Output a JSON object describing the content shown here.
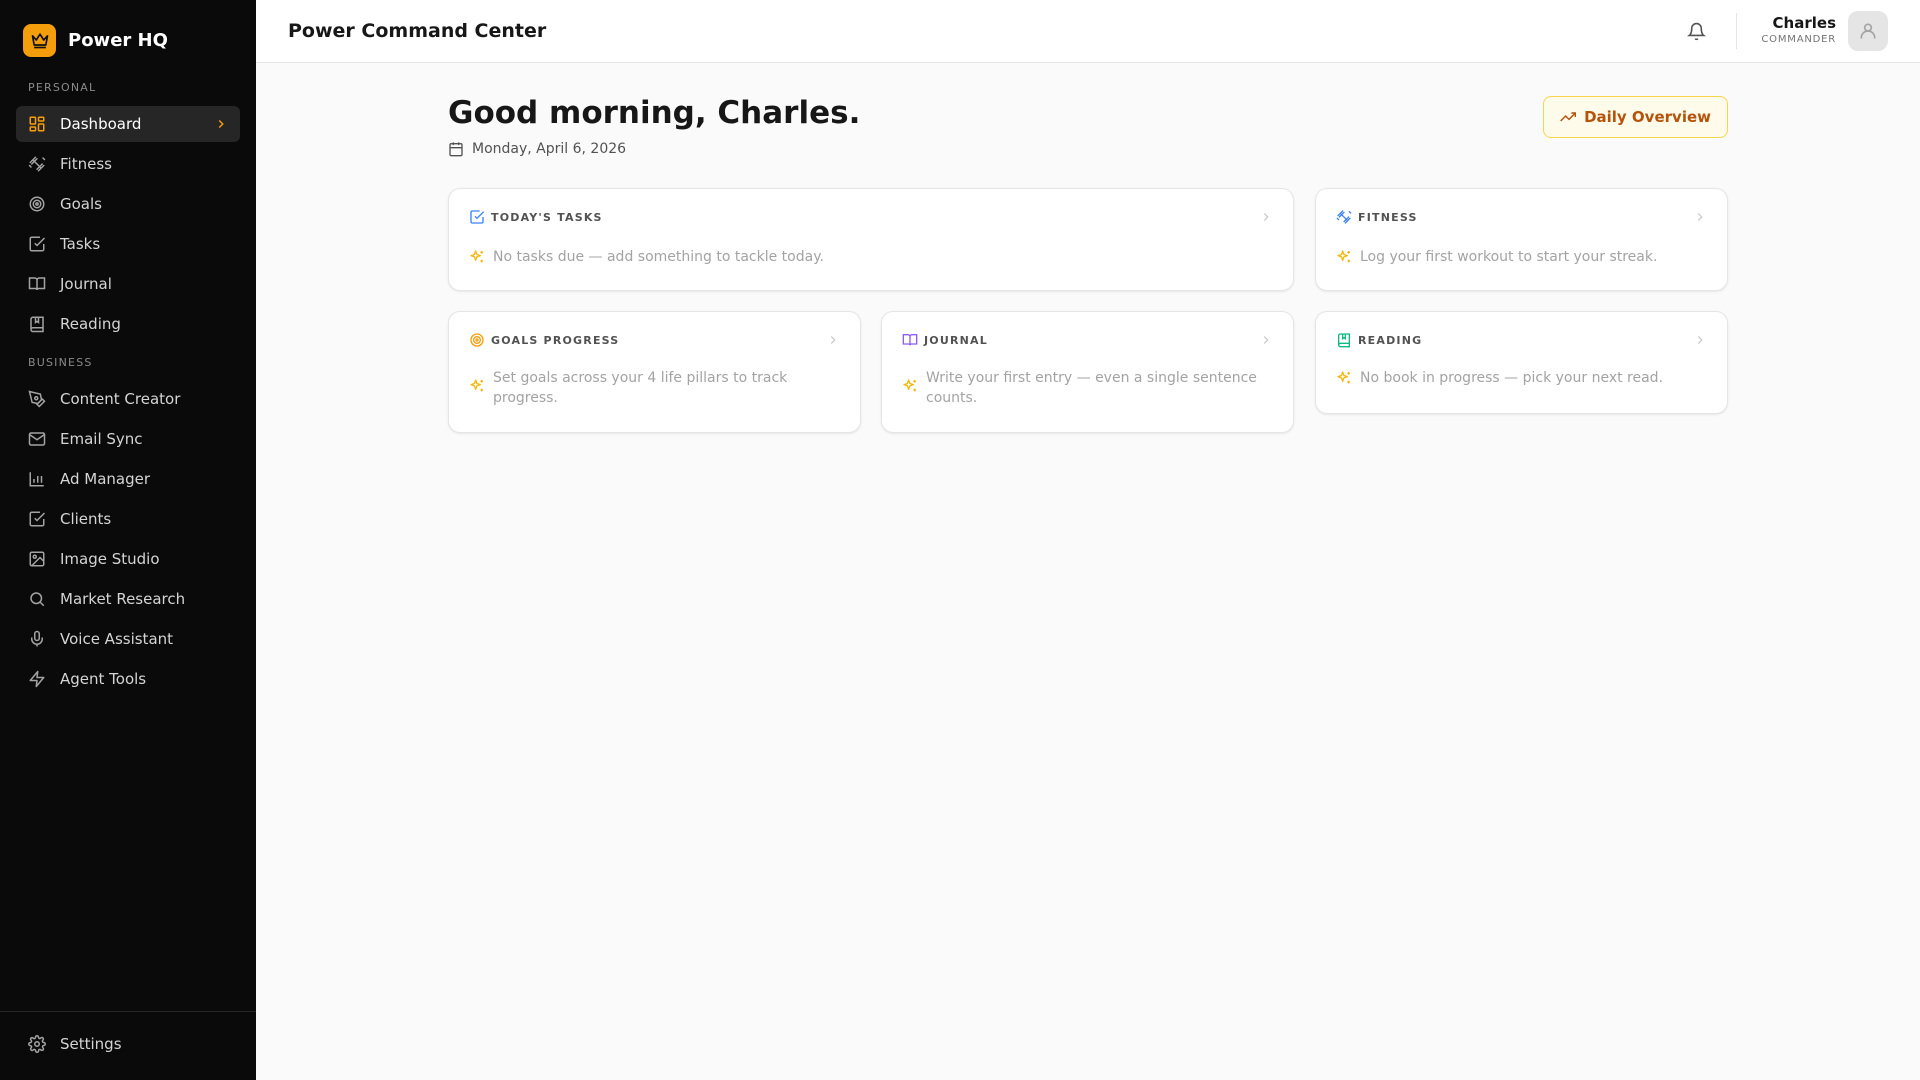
{
  "brand": {
    "name": "Power HQ",
    "icon": "crown-icon",
    "color": "#f59e0b"
  },
  "sidebar": {
    "personal_label": "PERSONAL",
    "business_label": "BUSINESS",
    "personal": [
      {
        "label": "Dashboard",
        "icon": "dashboard-icon",
        "active": true
      },
      {
        "label": "Fitness",
        "icon": "dumbbell-icon"
      },
      {
        "label": "Goals",
        "icon": "target-icon"
      },
      {
        "label": "Tasks",
        "icon": "check-square-icon"
      },
      {
        "label": "Journal",
        "icon": "book-open-icon"
      },
      {
        "label": "Reading",
        "icon": "bookmark-book-icon"
      }
    ],
    "business": [
      {
        "label": "Content Creator",
        "icon": "pen-tool-icon"
      },
      {
        "label": "Email Sync",
        "icon": "mail-icon"
      },
      {
        "label": "Ad Manager",
        "icon": "bar-chart-icon"
      },
      {
        "label": "Clients",
        "icon": "check-square-icon"
      },
      {
        "label": "Image Studio",
        "icon": "image-icon"
      },
      {
        "label": "Market Research",
        "icon": "search-icon"
      },
      {
        "label": "Voice Assistant",
        "icon": "mic-icon"
      },
      {
        "label": "Agent Tools",
        "icon": "zap-icon"
      }
    ],
    "settings_label": "Settings"
  },
  "header": {
    "title": "Power Command Center",
    "user_name": "Charles",
    "user_role": "COMMANDER"
  },
  "main": {
    "greeting": "Good morning, Charles.",
    "date": "Monday, April 6, 2026",
    "overview_button": "Daily Overview"
  },
  "cards": {
    "tasks": {
      "title": "TODAY'S TASKS",
      "text": "No tasks due — add something to tackle today.",
      "color": "#3b82f6"
    },
    "fitness": {
      "title": "FITNESS",
      "text": "Log your first workout to start your streak.",
      "color": "#3b82f6"
    },
    "goals": {
      "title": "GOALS PROGRESS",
      "text": "Set goals across your 4 life pillars to track progress.",
      "color": "#f59e0b"
    },
    "journal": {
      "title": "JOURNAL",
      "text": "Write your first entry — even a single sentence counts.",
      "color": "#8b5cf6"
    },
    "reading": {
      "title": "READING",
      "text": "No book in progress — pick your next read.",
      "color": "#10b981"
    }
  },
  "colors": {
    "accent": "#f59e0b",
    "sparkle": "#f5b70b"
  }
}
